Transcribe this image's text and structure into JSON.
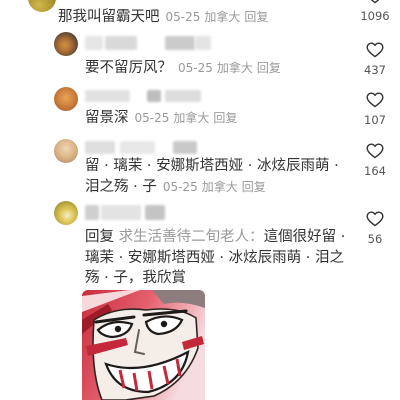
{
  "comments": [
    {
      "text": "那我叫留霸天吧",
      "date": "05-25",
      "location": "加拿大",
      "reply_label": "回复",
      "likes": 1096
    },
    {
      "text": "要不留厉风？",
      "date": "05-25",
      "location": "加拿大",
      "reply_label": "回复",
      "likes": 437
    },
    {
      "text": "留景深",
      "date": "05-25",
      "location": "加拿大",
      "reply_label": "回复",
      "likes": 107
    },
    {
      "text": "留 · 璃茉 · 安娜斯塔西娅 · 冰炫辰雨萌 · 泪之殇 · 子",
      "date": "05-25",
      "location": "加拿大",
      "reply_label": "回复",
      "likes": 164
    },
    {
      "reply_prefix": "回复",
      "reply_to": "求生活善待二旬老人：",
      "text": "這個很好留 · 璃茉 · 安娜斯塔西娅 · 冰炫辰雨萌 · 泪之殇 · 子，我欣賞",
      "likes": 56
    }
  ],
  "icons": {
    "like": "heart-outline-icon"
  },
  "colors": {
    "text": "#333333",
    "meta": "#9a9a9a",
    "count": "#555555",
    "background": "#ffffff"
  }
}
